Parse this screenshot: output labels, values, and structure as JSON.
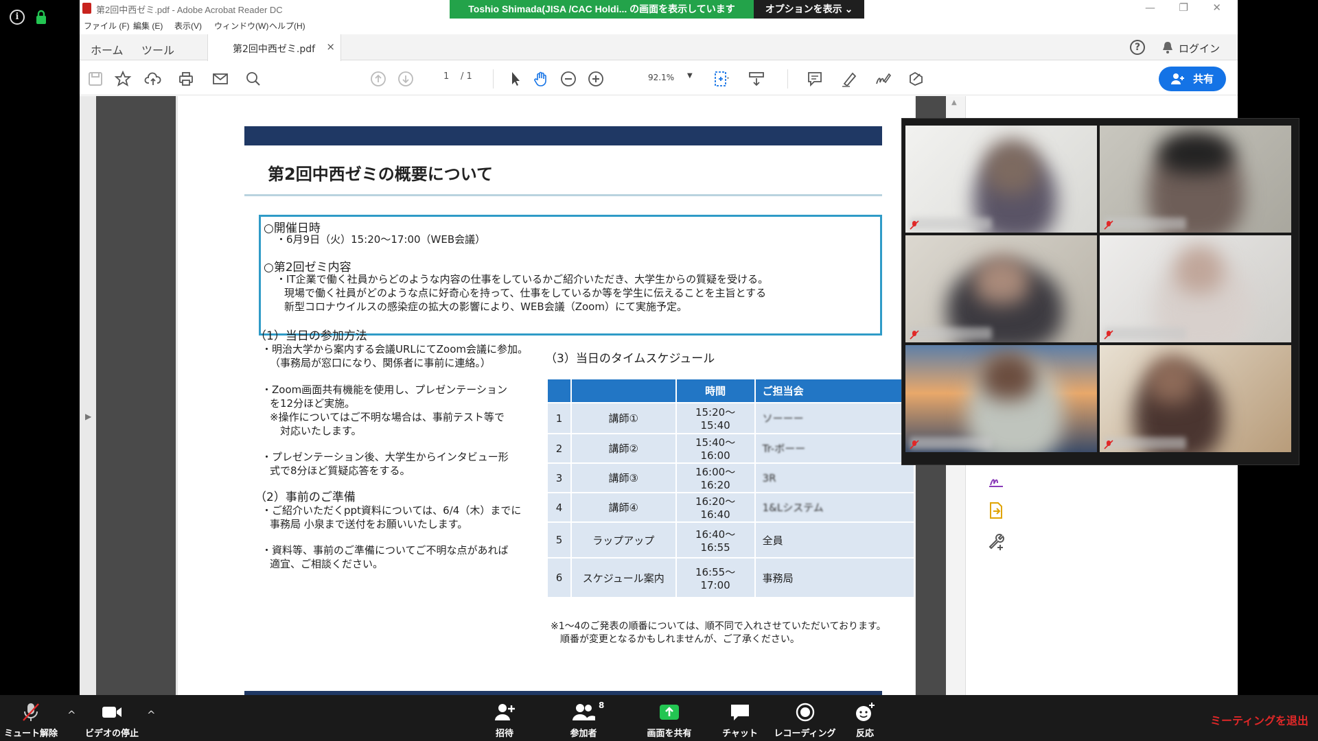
{
  "acrobat": {
    "window_title": "第2回中西ゼミ.pdf - Adobe Acrobat Reader DC",
    "menu": [
      "ファイル (F)",
      "編集 (E)",
      "表示(V)",
      "ウィンドウ(W)",
      "ヘルプ(H)"
    ],
    "tabs": {
      "home": "ホーム",
      "tools": "ツール",
      "document": "第2回中西ゼミ.pdf",
      "close": "×"
    },
    "login": "ログイン",
    "help": "?",
    "page_current": "1",
    "page_total": "/ 1",
    "zoom": "92.1%",
    "share_button": "共有"
  },
  "zoom_share": {
    "banner": "Toshio  Shimada(JISA  /CAC Holdi...  の画面を表示しています",
    "options": "オプションを表示 ⌄"
  },
  "document": {
    "title": "第2回中西ゼミの概要について",
    "box": [
      "○開催日時",
      "・6月9日（火）15:20～17:00（WEB会議）",
      "○第2回ゼミ内容",
      "・IT企業で働く社員からどのような内容の仕事をしているかご紹介いただき、大学生からの質疑を受ける。",
      "現場で働く社員がどのような点に好奇心を持って、仕事をしているか等を学生に伝えることを主旨とする",
      "新型コロナウイルスの感染症の拡大の影響により、WEB会議（Zoom）にて実施予定。"
    ],
    "section1": {
      "heading": "（1）当日の参加方法",
      "lines": [
        "・明治大学から案内する会議URLにてZoom会議に参加。",
        "（事務局が窓口になり、関係者に事前に連絡。）",
        "・Zoom画面共有機能を使用し、プレゼンテーション",
        "を12分ほど実施。",
        "※操作についてはご不明な場合は、事前テスト等で",
        "対応いたします。",
        "・プレゼンテーション後、大学生からインタビュー形",
        "式で8分ほど質疑応答をする。"
      ]
    },
    "section2": {
      "heading": "（2）事前のご準備",
      "lines": [
        "・ご紹介いただくppt資料については、6/4（木）までに",
        "事務局 小泉まで送付をお願いいたします。",
        "・資料等、事前のご準備についてご不明な点があれば",
        "適宜、ご相談ください。"
      ]
    },
    "section3": {
      "heading": "（3）当日のタイムスケジュール",
      "headers": [
        "",
        "",
        "時間",
        "ご担当会"
      ],
      "rows": [
        {
          "no": "1",
          "role": "講師①",
          "time": "15:20～15:40",
          "who": "ソーーー"
        },
        {
          "no": "2",
          "role": "講師②",
          "time": "15:40～16:00",
          "who": "Tr-ボーー"
        },
        {
          "no": "3",
          "role": "講師③",
          "time": "16:00～16:20",
          "who": "3R"
        },
        {
          "no": "4",
          "role": "講師④",
          "time": "16:20～16:40",
          "who": "1&Lシステム"
        },
        {
          "no": "5",
          "role": "ラップアップ",
          "time": "16:40～16:55",
          "who": "全員"
        },
        {
          "no": "6",
          "role": "スケジュール案内",
          "time": "16:55～17:00",
          "who": "事務局"
        }
      ],
      "notes": [
        "※1～4のご発表の順番については、順不同で入れさせていただいております。",
        "順番が変更となるかもしれませんが、ご了承ください。"
      ]
    }
  },
  "zoom_bar": {
    "unmute": "ミュート解除",
    "stop_video": "ビデオの停止",
    "invite": "招待",
    "participants": "参加者",
    "participant_count": "8",
    "share_screen": "画面を共有",
    "chat": "チャット",
    "recording": "レコーディング",
    "reactions": "反応",
    "leave": "ミーティングを退出",
    "caret": "^"
  },
  "colors": {
    "zoom_green": "#23a34a",
    "share_blue": "#1473e6",
    "leave_red": "#e02828",
    "table_head": "#2276c5"
  }
}
